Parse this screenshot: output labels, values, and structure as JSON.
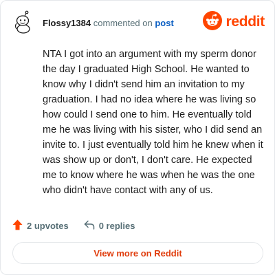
{
  "header": {
    "username": "Flossy1384",
    "commented_text": "commented on",
    "post_link": "post",
    "brand": "reddit",
    "avatar_icon": "snoo-avatar-icon",
    "logo_icon": "reddit-logo-icon"
  },
  "comment": {
    "body": "NTA I got into an argument with my sperm donor the day I graduated High School. He wanted to know why I didn't send him an invitation to my graduation. I had no idea where he was living so how could I send one to him. He eventually told me he was living with his sister, who I did send an invite to. I just eventually told him he knew when it was show up or don't, I don't care. He expected me to know where he was when he was the one who didn't have contact with any of us."
  },
  "footer": {
    "upvotes_label": "2 upvotes",
    "replies_label": "0 replies",
    "upvote_icon": "upvote-arrow-icon",
    "reply_icon": "reply-arrow-icon",
    "upvote_color": "#ff4500"
  },
  "cta": {
    "label": "View more on Reddit"
  },
  "colors": {
    "brand": "#ff4500",
    "link": "#0a5ec2",
    "muted": "#576f76"
  }
}
